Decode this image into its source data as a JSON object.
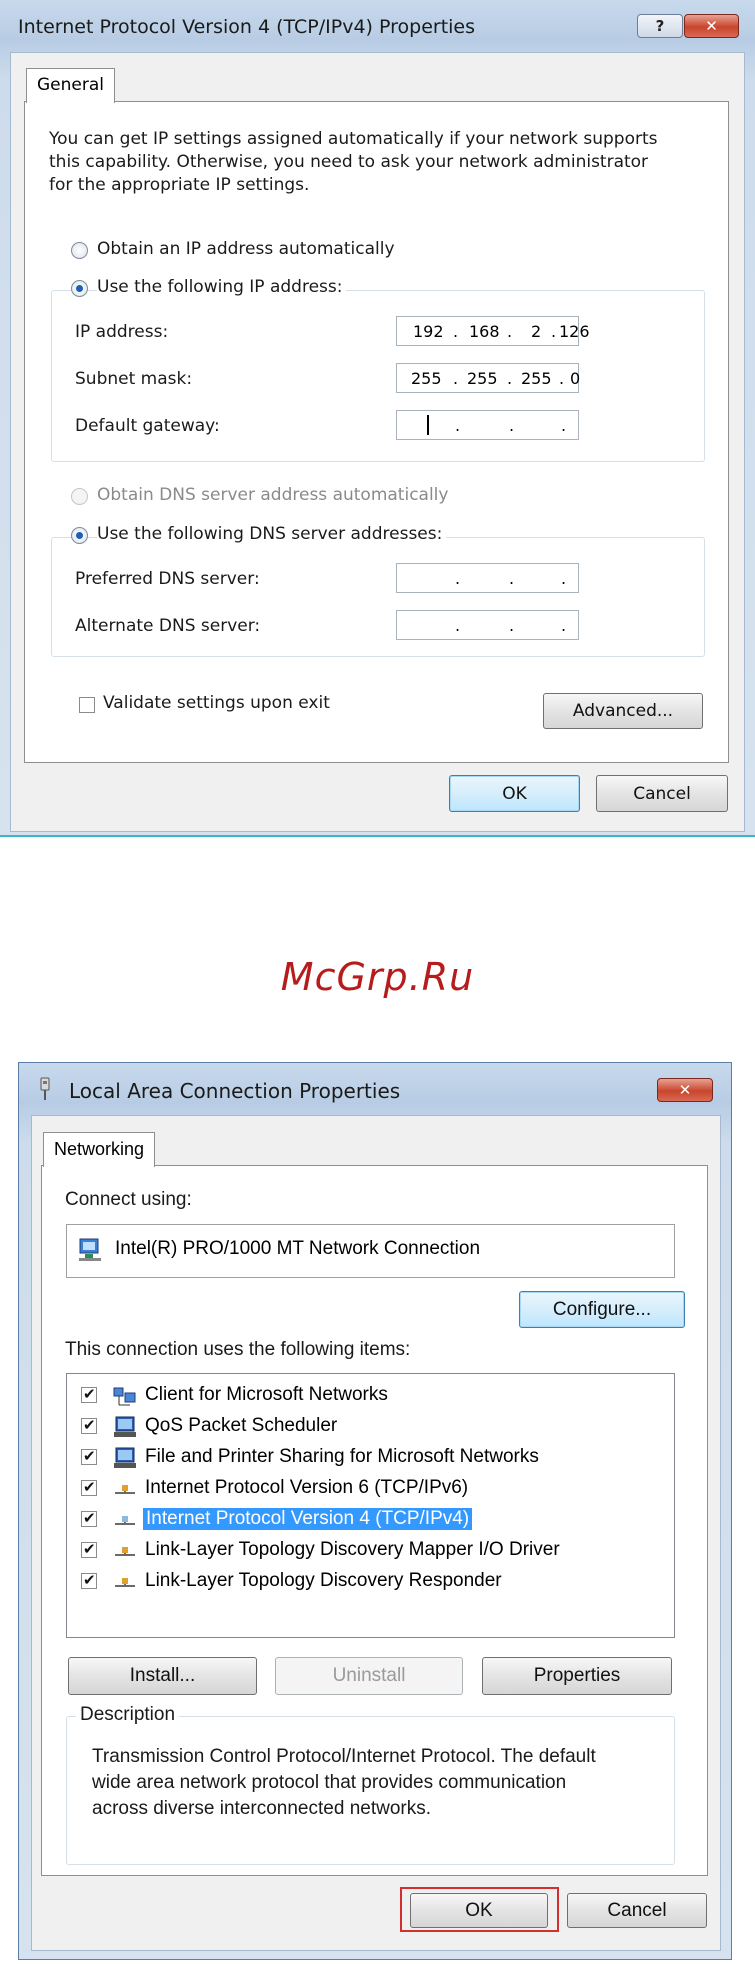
{
  "ipv4_dialog": {
    "title": "Internet Protocol Version 4 (TCP/IPv4) Properties",
    "help_glyph": "?",
    "close_glyph": "✕",
    "tab_general": "General",
    "intro_line1": "You can get IP settings assigned automatically if your network supports",
    "intro_line2": "this capability. Otherwise, you need to ask your network administrator",
    "intro_line3": "for the appropriate IP settings.",
    "radio_ip_auto": "Obtain an IP address automatically",
    "radio_ip_manual": "Use the following IP address:",
    "ip_label": "IP address:",
    "ip_value": [
      "192",
      "168",
      "2",
      "126"
    ],
    "subnet_label": "Subnet mask:",
    "subnet_value": [
      "255",
      "255",
      "255",
      "0"
    ],
    "gateway_label": "Default gateway:",
    "radio_dns_auto": "Obtain DNS server address automatically",
    "radio_dns_manual": "Use the following DNS server addresses:",
    "preferred_dns_label": "Preferred DNS server:",
    "alternate_dns_label": "Alternate DNS server:",
    "dot": ".",
    "validate_label": "Validate settings upon exit",
    "advanced_label": "Advanced...",
    "ok_label": "OK",
    "cancel_label": "Cancel"
  },
  "watermark": "McGrp.Ru",
  "lan_dialog": {
    "title": "Local Area Connection Properties",
    "close_glyph": "✕",
    "tab_networking": "Networking",
    "connect_using_label": "Connect using:",
    "adapter_name": "Intel(R) PRO/1000 MT Network Connection",
    "configure_label": "Configure...",
    "items_label": "This connection uses the following items:",
    "items": [
      {
        "label": "Client for Microsoft Networks",
        "checked": true,
        "icon": "network-client-icon"
      },
      {
        "label": "QoS Packet Scheduler",
        "checked": true,
        "icon": "computer-service-icon"
      },
      {
        "label": "File and Printer Sharing for Microsoft Networks",
        "checked": true,
        "icon": "computer-service-icon"
      },
      {
        "label": "Internet Protocol Version 6 (TCP/IPv6)",
        "checked": true,
        "icon": "protocol-icon"
      },
      {
        "label": "Internet Protocol Version 4 (TCP/IPv4)",
        "checked": true,
        "icon": "protocol-icon",
        "selected": true
      },
      {
        "label": "Link-Layer Topology Discovery Mapper I/O Driver",
        "checked": true,
        "icon": "protocol-icon"
      },
      {
        "label": "Link-Layer Topology Discovery Responder",
        "checked": true,
        "icon": "protocol-icon"
      }
    ],
    "install_label": "Install...",
    "uninstall_label": "Uninstall",
    "properties_label": "Properties",
    "description_title": "Description",
    "description_line1": "Transmission Control Protocol/Internet Protocol. The default",
    "description_line2": "wide area network protocol that provides communication",
    "description_line3": "across diverse interconnected networks.",
    "ok_label": "OK",
    "cancel_label": "Cancel"
  },
  "colors": {
    "selection": "#3399ff",
    "separator": "#3fb6c4",
    "watermark": "#b71c1c",
    "ok_highlight": "#d32f2f"
  }
}
